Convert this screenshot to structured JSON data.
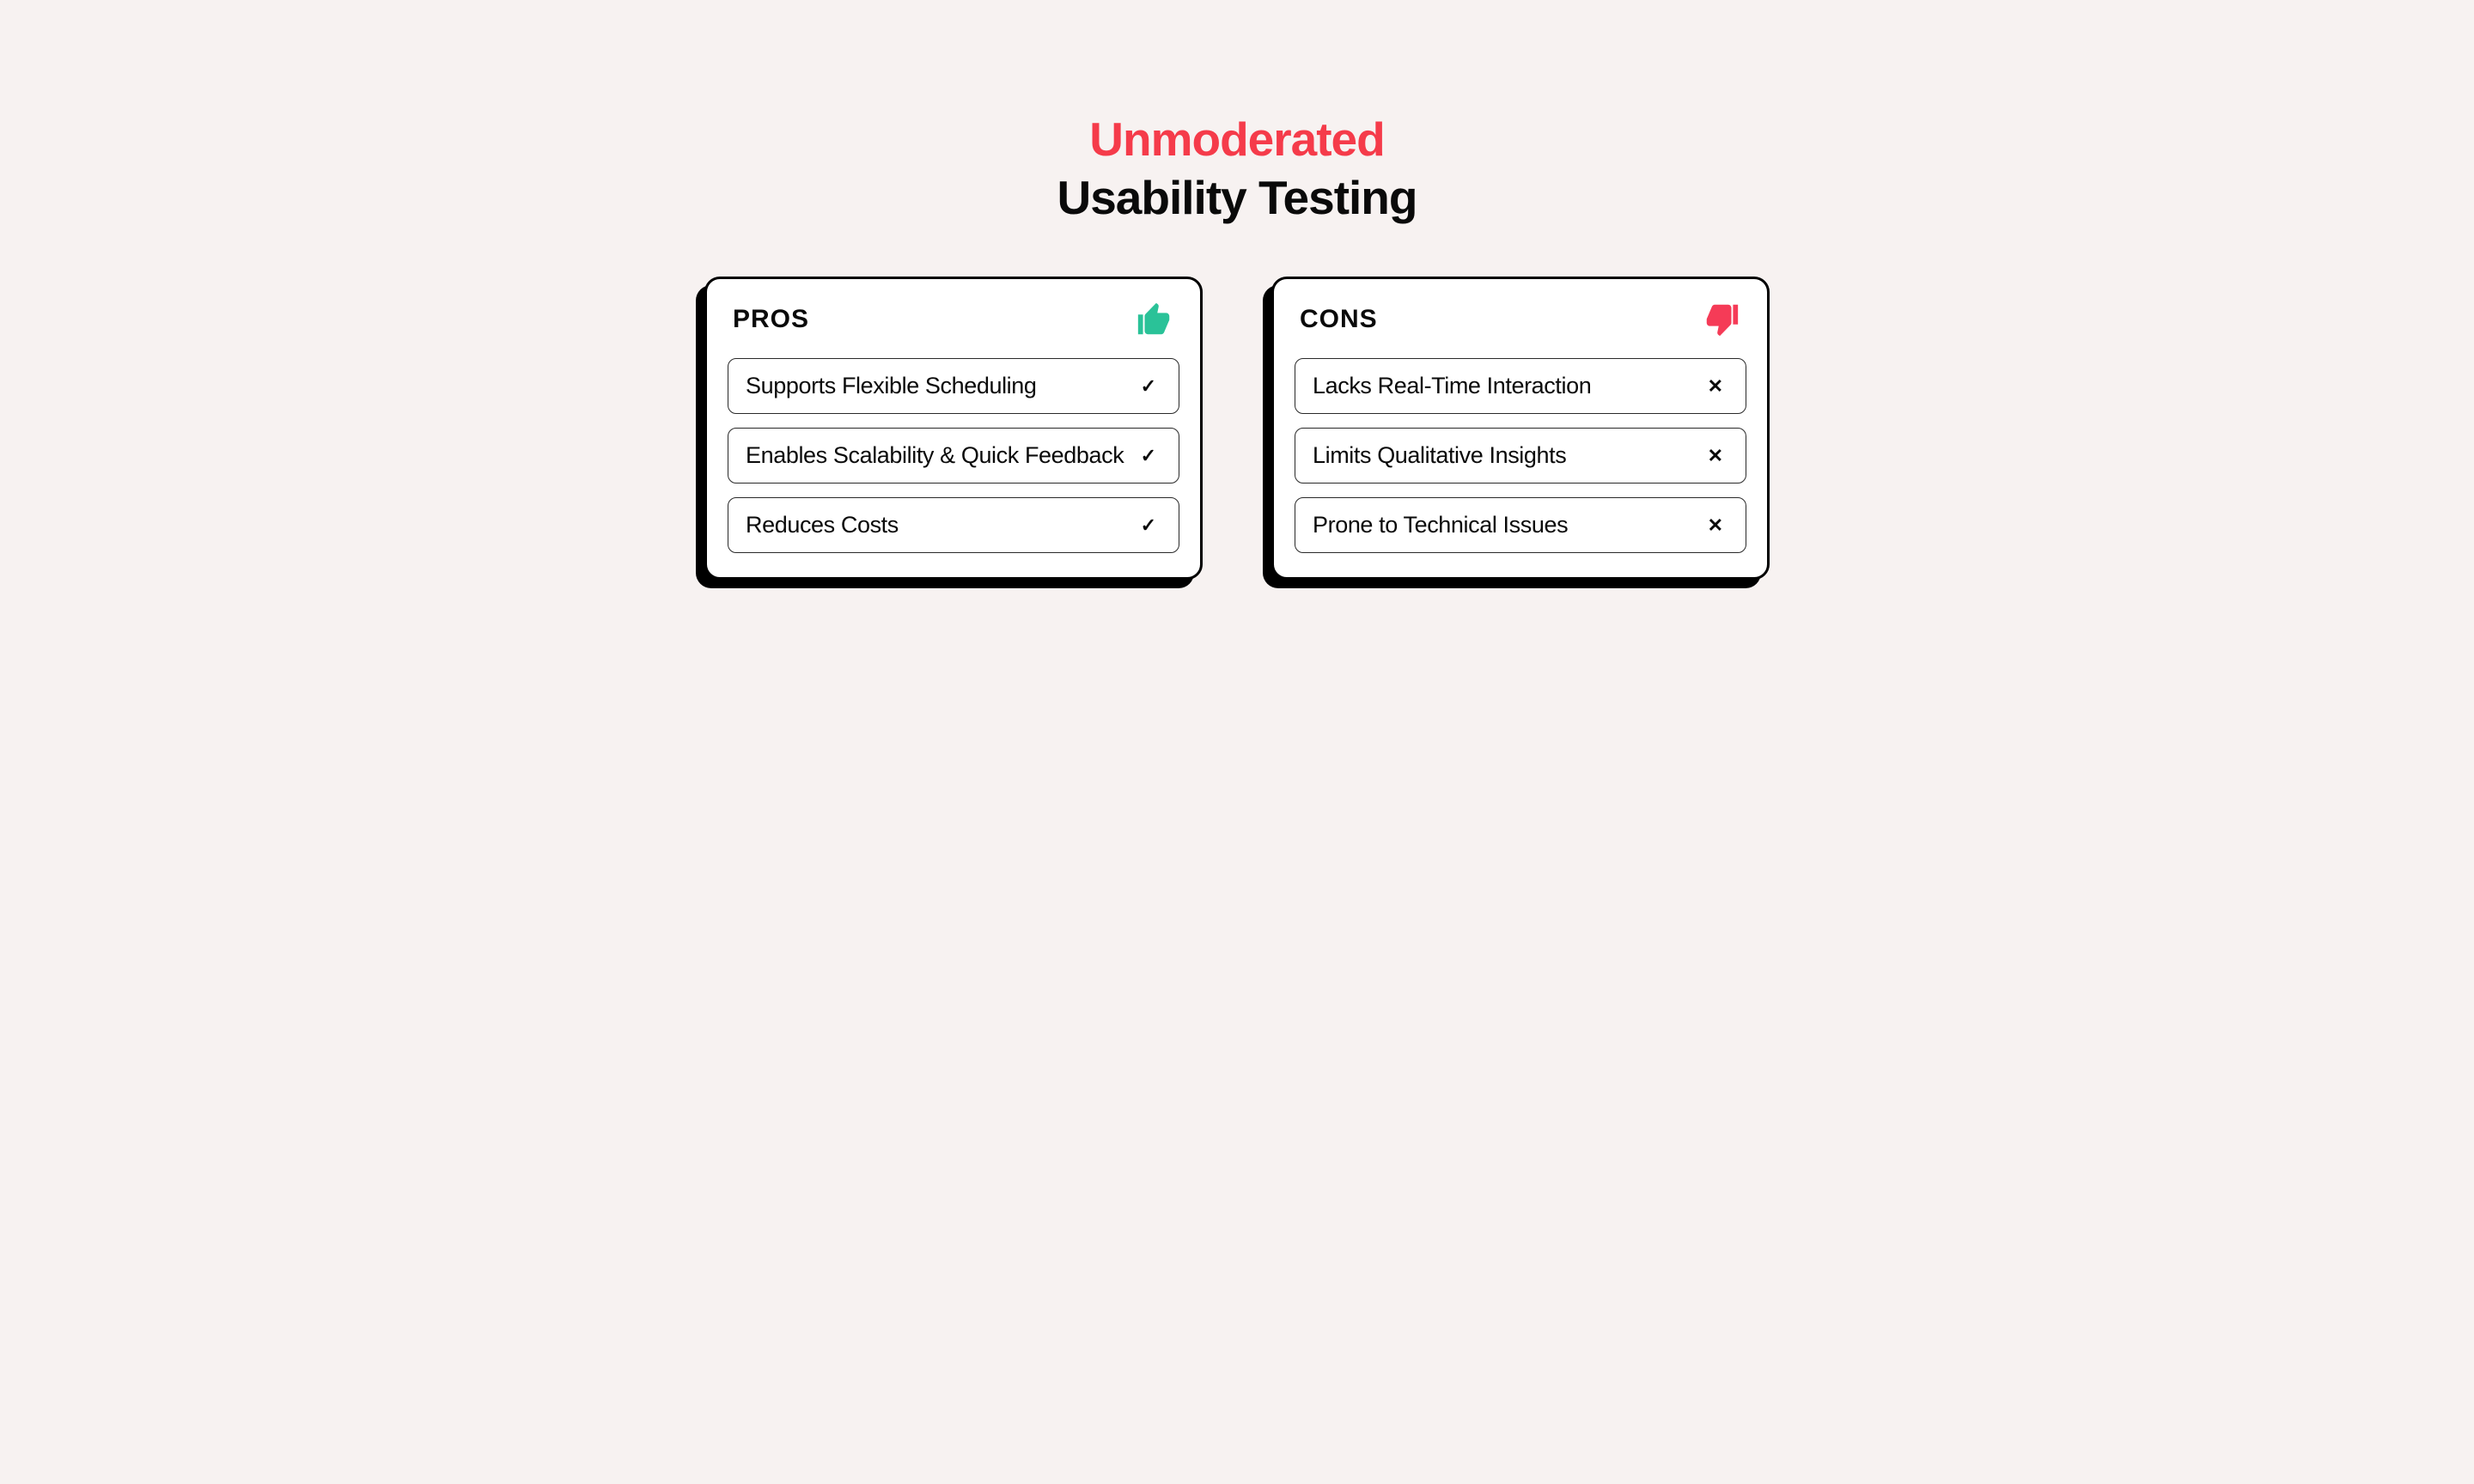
{
  "title": {
    "top": "Unmoderated",
    "bottom": "Usability Testing"
  },
  "pros": {
    "heading": "PROS",
    "icon_color": "#2ac298",
    "items": [
      {
        "text": "Supports Flexible Scheduling",
        "mark": "✓"
      },
      {
        "text": "Enables Scalability & Quick Feedback",
        "mark": "✓"
      },
      {
        "text": "Reduces Costs",
        "mark": "✓"
      }
    ]
  },
  "cons": {
    "heading": "CONS",
    "icon_color": "#f53b57",
    "items": [
      {
        "text": "Lacks Real-Time Interaction",
        "mark": "✕"
      },
      {
        "text": "Limits Qualitative Insights",
        "mark": "✕"
      },
      {
        "text": "Prone to Technical Issues",
        "mark": "✕"
      }
    ]
  }
}
